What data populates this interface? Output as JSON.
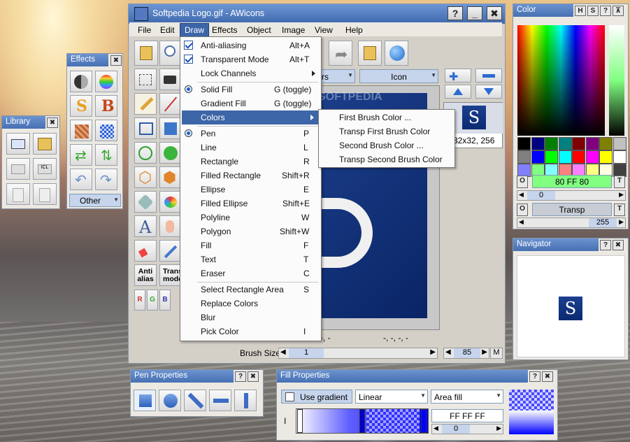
{
  "main_window": {
    "title": "Softpedia Logo.gif - AWicons",
    "buttons": {
      "help": "?",
      "minimize": "_",
      "close": "✖"
    }
  },
  "menubar": {
    "items": [
      "File",
      "Edit",
      "Draw",
      "Effects",
      "Object",
      "Image",
      "View",
      "Help"
    ],
    "active": "Draw"
  },
  "draw_menu": {
    "items": [
      {
        "label": "Anti-aliasing",
        "shortcut": "Alt+A",
        "mark": "check"
      },
      {
        "label": "Transparent Mode",
        "shortcut": "Alt+T",
        "mark": "check"
      },
      {
        "label": "Lock Channels",
        "shortcut": "",
        "mark": "submenu"
      },
      {
        "label": "Solid Fill",
        "shortcut": "G (toggle)",
        "mark": "radio"
      },
      {
        "label": "Gradient Fill",
        "shortcut": "G (toggle)",
        "mark": ""
      },
      {
        "label": "Colors",
        "shortcut": "",
        "mark": "submenu"
      },
      {
        "label": "Pen",
        "shortcut": "P",
        "mark": "radio"
      },
      {
        "label": "Line",
        "shortcut": "L",
        "mark": ""
      },
      {
        "label": "Rectangle",
        "shortcut": "R",
        "mark": ""
      },
      {
        "label": "Filled Rectangle",
        "shortcut": "Shift+R",
        "mark": ""
      },
      {
        "label": "Ellipse",
        "shortcut": "E",
        "mark": ""
      },
      {
        "label": "Filled Ellipse",
        "shortcut": "Shift+E",
        "mark": ""
      },
      {
        "label": "Polyline",
        "shortcut": "W",
        "mark": ""
      },
      {
        "label": "Polygon",
        "shortcut": "Shift+W",
        "mark": ""
      },
      {
        "label": "Fill",
        "shortcut": "F",
        "mark": ""
      },
      {
        "label": "Text",
        "shortcut": "T",
        "mark": ""
      },
      {
        "label": "Eraser",
        "shortcut": "C",
        "mark": ""
      },
      {
        "label": "Select Rectangle Area",
        "shortcut": "S",
        "mark": ""
      },
      {
        "label": "Replace Colors",
        "shortcut": "",
        "mark": ""
      },
      {
        "label": "Blur",
        "shortcut": "",
        "mark": ""
      },
      {
        "label": "Pick Color",
        "shortcut": "I",
        "mark": ""
      }
    ]
  },
  "colors_submenu": {
    "items": [
      "First Brush Color ...",
      "Transp First Brush Color",
      "Second Brush Color ...",
      "Transp Second Brush Color"
    ]
  },
  "toolbar": {
    "combo_partial": "rs",
    "icon_combo": "Icon",
    "preview_letter": "S",
    "preview_size": "32x32, 256"
  },
  "canvas": {
    "coords_left": "-, -",
    "coords_right": "-, -, -, -",
    "brush_size_label": "Brush Size",
    "brush_size_value": "1",
    "zoom_value": "85",
    "zoom_btn": "M"
  },
  "tool_labels": {
    "anti_alias_1": "Anti",
    "anti_alias_2": "alias",
    "transp_1": "Trans",
    "transp_2": "mode",
    "r": "R",
    "g": "G",
    "b": "B"
  },
  "effects_panel": {
    "title": "Effects",
    "other": "Other"
  },
  "library_panel": {
    "title": "Library"
  },
  "color_panel": {
    "title": "Color",
    "buttons": {
      "h": "H",
      "s": "S",
      "help": "?",
      "pin": "⊼"
    },
    "first_color": "80 FF 80",
    "first_alpha": "0",
    "second_color": "Transp",
    "second_alpha": "255",
    "o": "O",
    "t": "T",
    "swatches_row1": [
      "#000000",
      "#000080",
      "#008000",
      "#008080",
      "#800000",
      "#800080",
      "#808000",
      "#c0c0c0"
    ],
    "swatches_row2": [
      "#808080",
      "#0000ff",
      "#00ff00",
      "#00ffff",
      "#ff0000",
      "#ff00ff",
      "#ffff00",
      "#ffffff"
    ],
    "swatches_row3": [
      "#8080ff",
      "#80ff80",
      "#80ffff",
      "#ff8080",
      "#ff80ff",
      "#ffff80",
      "#ffffe0",
      "#404040"
    ],
    "fill_color": "#80ff80"
  },
  "navigator": {
    "title": "Navigator",
    "letter": "S"
  },
  "pen_properties": {
    "title": "Pen Properties"
  },
  "fill_properties": {
    "title": "Fill Properties",
    "use_gradient": "Use gradient",
    "type": "Linear",
    "area": "Area fill",
    "color": "FF FF FF",
    "alpha": "0",
    "i": "I"
  },
  "watermark": "SOFTPEDIA"
}
